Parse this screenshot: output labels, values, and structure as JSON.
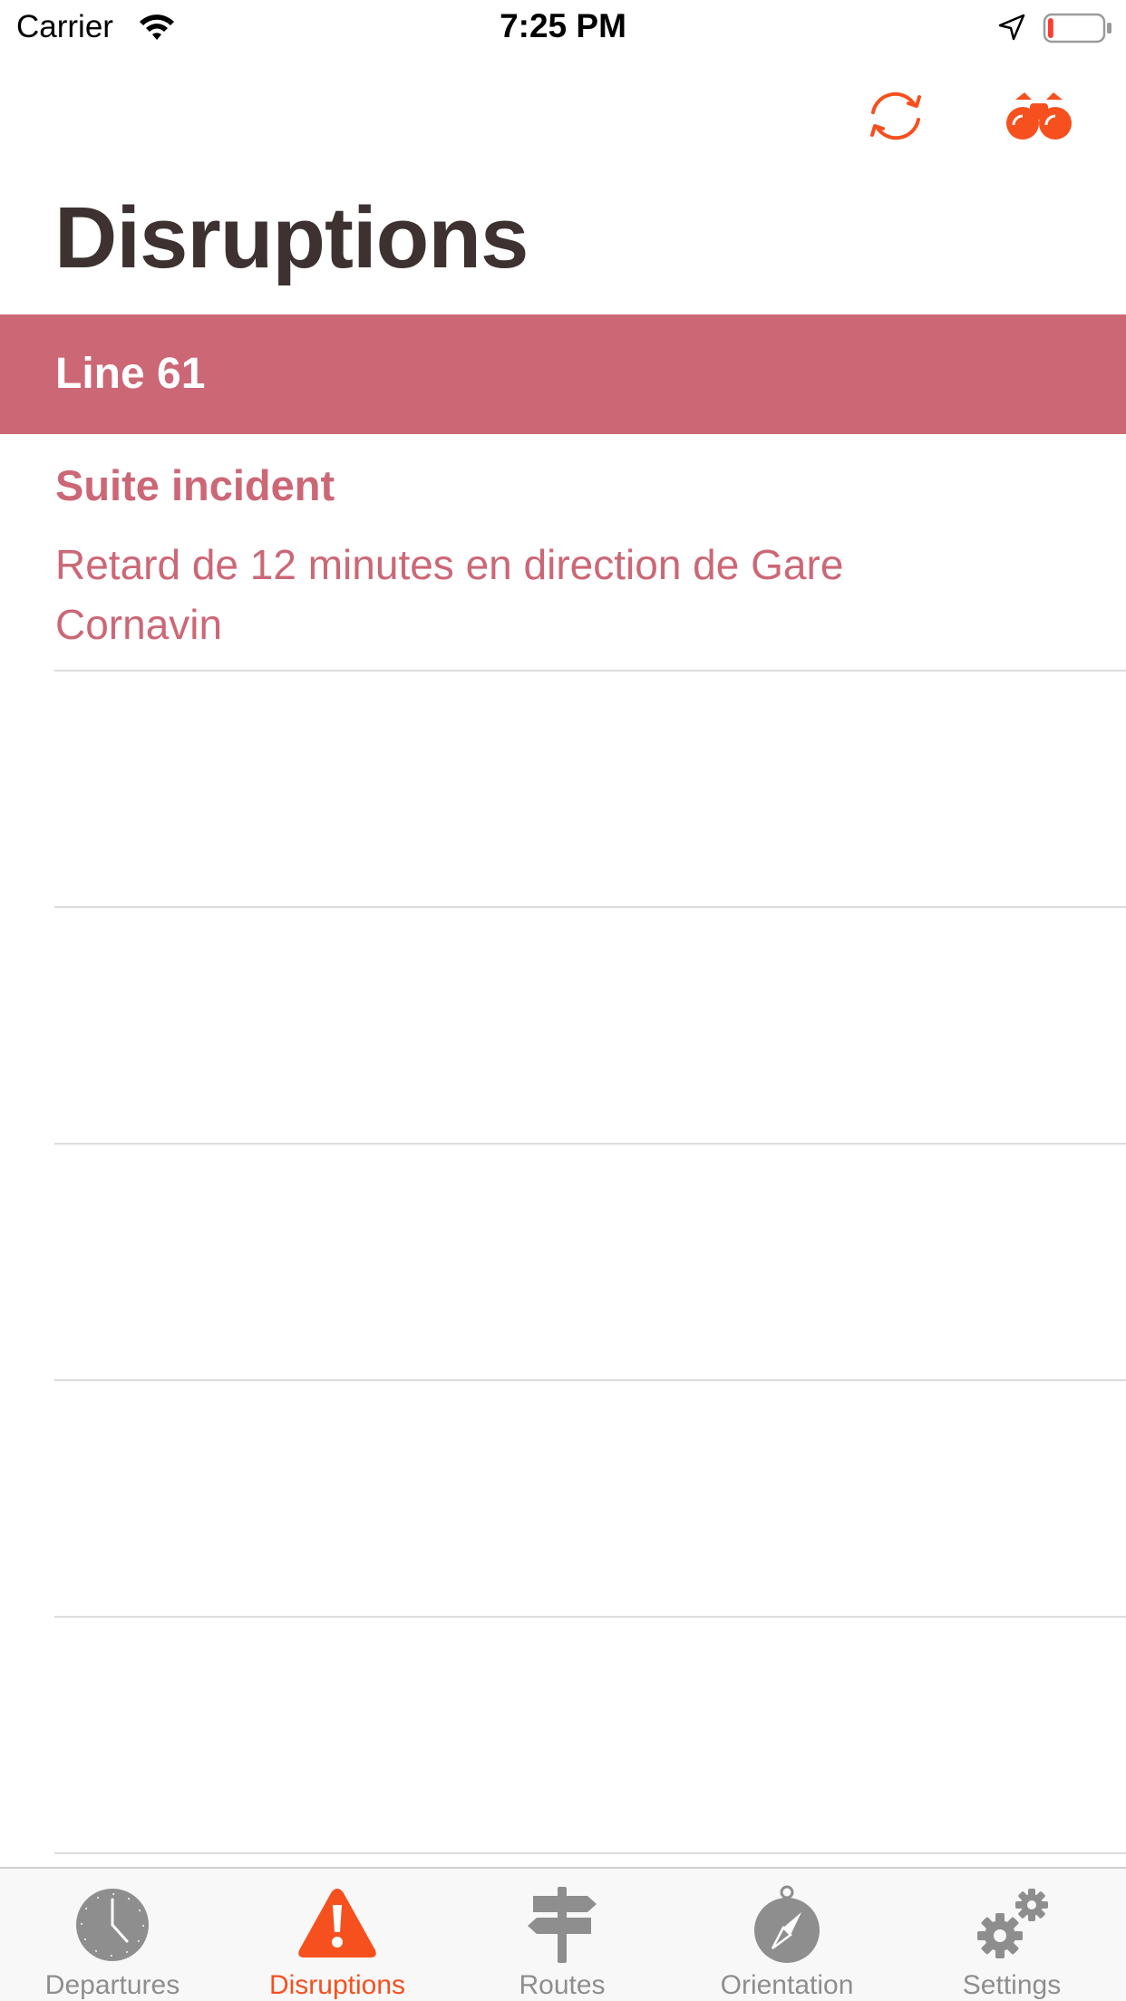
{
  "status_bar": {
    "carrier": "Carrier",
    "time": "7:25 PM",
    "battery_level": 0.1
  },
  "nav": {
    "actions": [
      {
        "icon": "refresh-icon"
      },
      {
        "icon": "binoculars-icon"
      }
    ],
    "accent_color": "#f5501e"
  },
  "page": {
    "title": "Disruptions"
  },
  "sections": [
    {
      "title": "Line 61",
      "header_color": "#cc6776",
      "items": [
        {
          "title": "Suite incident",
          "text": "Retard de 12 minutes en direction de Gare Cornavin"
        }
      ]
    }
  ],
  "tab_bar": {
    "active_color": "#f5501e",
    "inactive_color": "#8e8e8e",
    "tabs": [
      {
        "label": "Departures",
        "icon": "clock-icon",
        "active": false
      },
      {
        "label": "Disruptions",
        "icon": "warning-icon",
        "active": true
      },
      {
        "label": "Routes",
        "icon": "signpost-icon",
        "active": false
      },
      {
        "label": "Orientation",
        "icon": "compass-icon",
        "active": false
      },
      {
        "label": "Settings",
        "icon": "gears-icon",
        "active": false
      }
    ]
  }
}
